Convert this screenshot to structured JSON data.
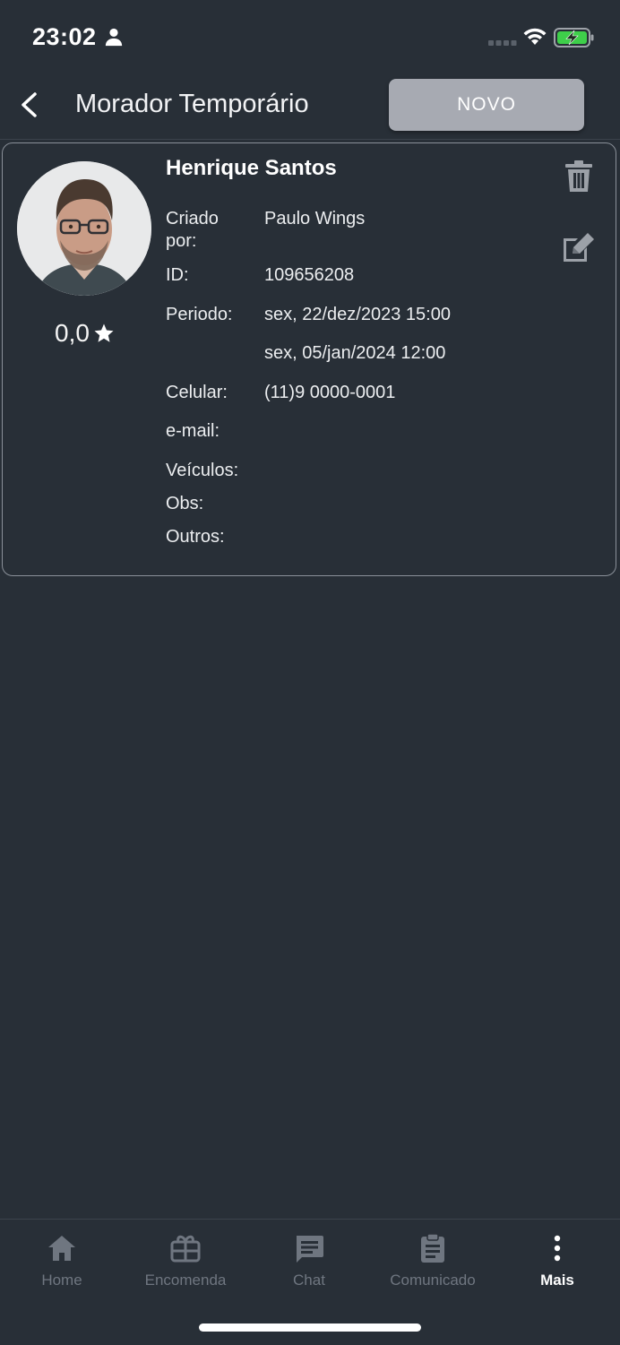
{
  "status_bar": {
    "time": "23:02",
    "icons": [
      "person-icon",
      "signal-icon",
      "wifi-icon",
      "battery-charging-icon"
    ],
    "battery_color": "#3ecf4a"
  },
  "header": {
    "back_icon": "chevron-left-icon",
    "title": "Morador Temporário",
    "new_button_label": "NOVO"
  },
  "card": {
    "avatar_icon": "person-photo",
    "rating": "0,0",
    "rating_icon": "star-icon",
    "name": "Henrique Santos",
    "actions": [
      "trash-icon",
      "edit-icon"
    ],
    "fields": {
      "created_by": {
        "label": "Criado por:",
        "value": "Paulo Wings"
      },
      "id": {
        "label": "ID:",
        "value": "109656208"
      },
      "period": {
        "label": "Periodo:",
        "start": "sex, 22/dez/2023 15:00",
        "end": "sex, 05/jan/2024 12:00"
      },
      "phone": {
        "label": "Celular:",
        "value": "(11)9 0000-0001"
      },
      "email": {
        "label": "e-mail:",
        "value": ""
      },
      "vehicles": {
        "label": "Veículos:",
        "value": ""
      },
      "notes": {
        "label": "Obs:",
        "value": ""
      },
      "others": {
        "label": "Outros:",
        "value": ""
      }
    }
  },
  "bottom_nav": {
    "items": [
      {
        "label": "Home",
        "icon": "home-icon",
        "active": false
      },
      {
        "label": "Encomenda",
        "icon": "package-icon",
        "active": false
      },
      {
        "label": "Chat",
        "icon": "chat-icon",
        "active": false
      },
      {
        "label": "Comunicado",
        "icon": "clipboard-icon",
        "active": false
      },
      {
        "label": "Mais",
        "icon": "more-vertical-icon",
        "active": true
      }
    ],
    "inactive_color": "#6f7680",
    "active_color": "#ffffff"
  }
}
